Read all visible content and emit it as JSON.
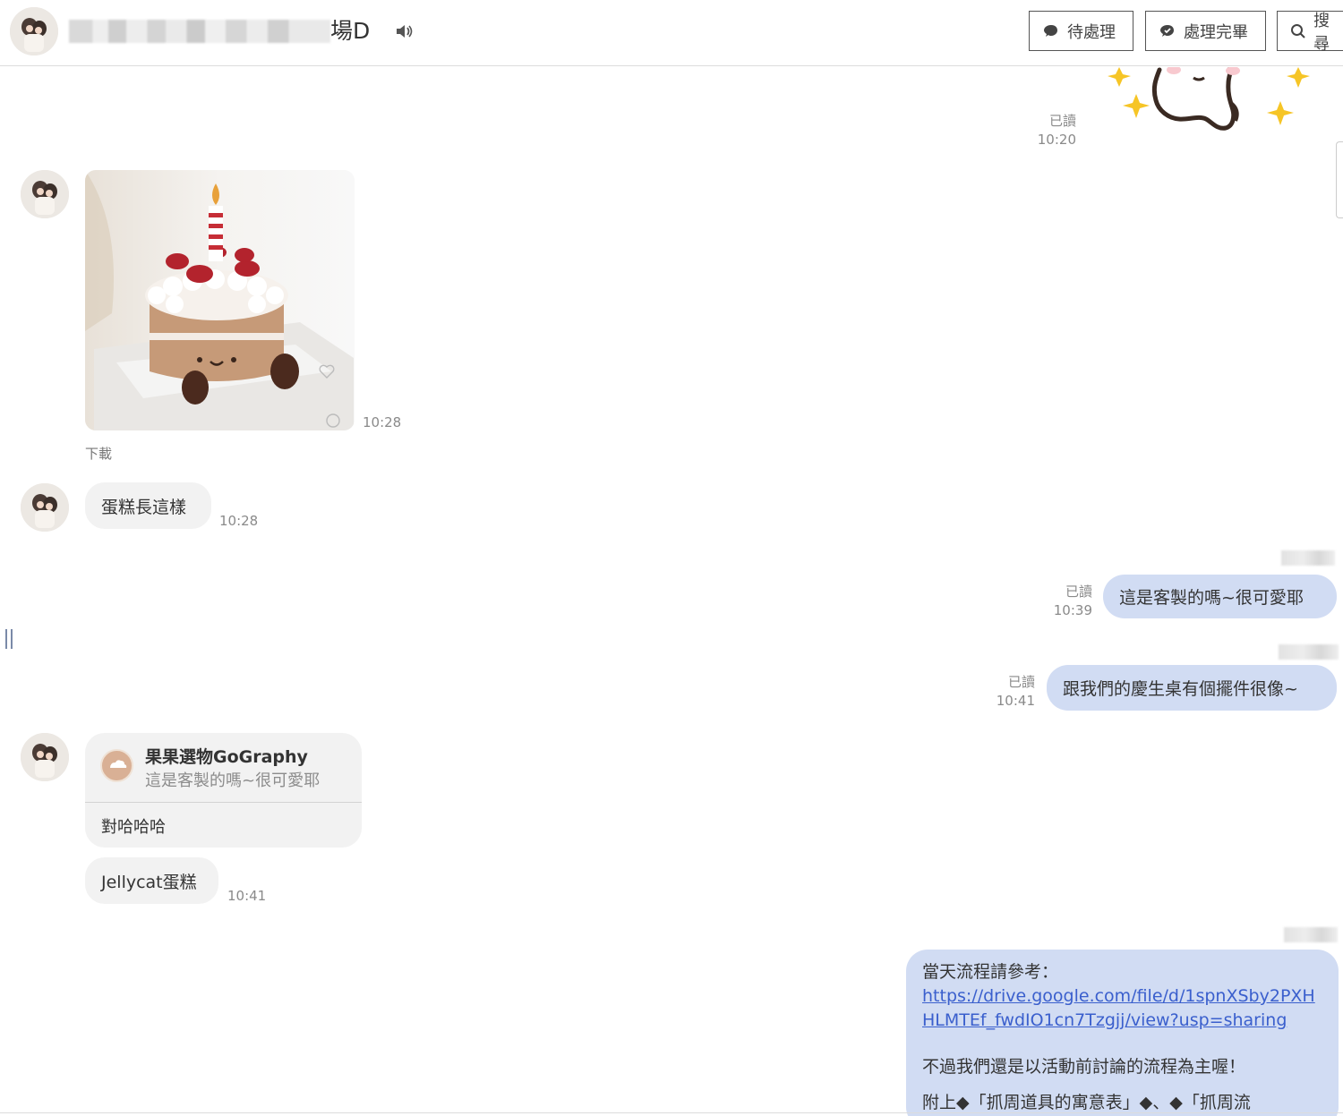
{
  "header": {
    "title_suffix": "場D",
    "buttons": {
      "pending_label": "待處理",
      "done_label": "處理完畢",
      "search_label": "搜尋"
    }
  },
  "messages": {
    "m1": {
      "read": "已讀",
      "time": "10:20"
    },
    "m2": {
      "time": "10:28",
      "download": "下載"
    },
    "m3": {
      "text": "蛋糕長這樣",
      "time": "10:28"
    },
    "m4": {
      "read": "已讀",
      "time": "10:39",
      "text": "這是客製的嗎~很可愛耶"
    },
    "m5": {
      "read": "已讀",
      "time": "10:41",
      "text": "跟我們的慶生桌有個擺件很像~"
    },
    "m6": {
      "quote_name": "果果選物GoGraphy",
      "quote_text": "這是客製的嗎~很可愛耶",
      "reply": "對哈哈哈"
    },
    "m7": {
      "text": "Jellycat蛋糕",
      "time": "10:41"
    },
    "m8": {
      "line1": "當天流程請參考：",
      "link": "https://drive.google.com/file/d/1spnXSby2PXHHLMTEf_fwdIO1cn7Tzgjj/view?usp=sharing",
      "line2": "不過我們還是以活動前討論的流程為主喔！",
      "line3": "附上◆「抓周道具的寓意表」◆、◆「抓周流"
    }
  },
  "colors": {
    "outgoing_bubble": "#d1dcf3",
    "incoming_bubble": "#f2f2f2",
    "link": "#3a5fcd"
  }
}
